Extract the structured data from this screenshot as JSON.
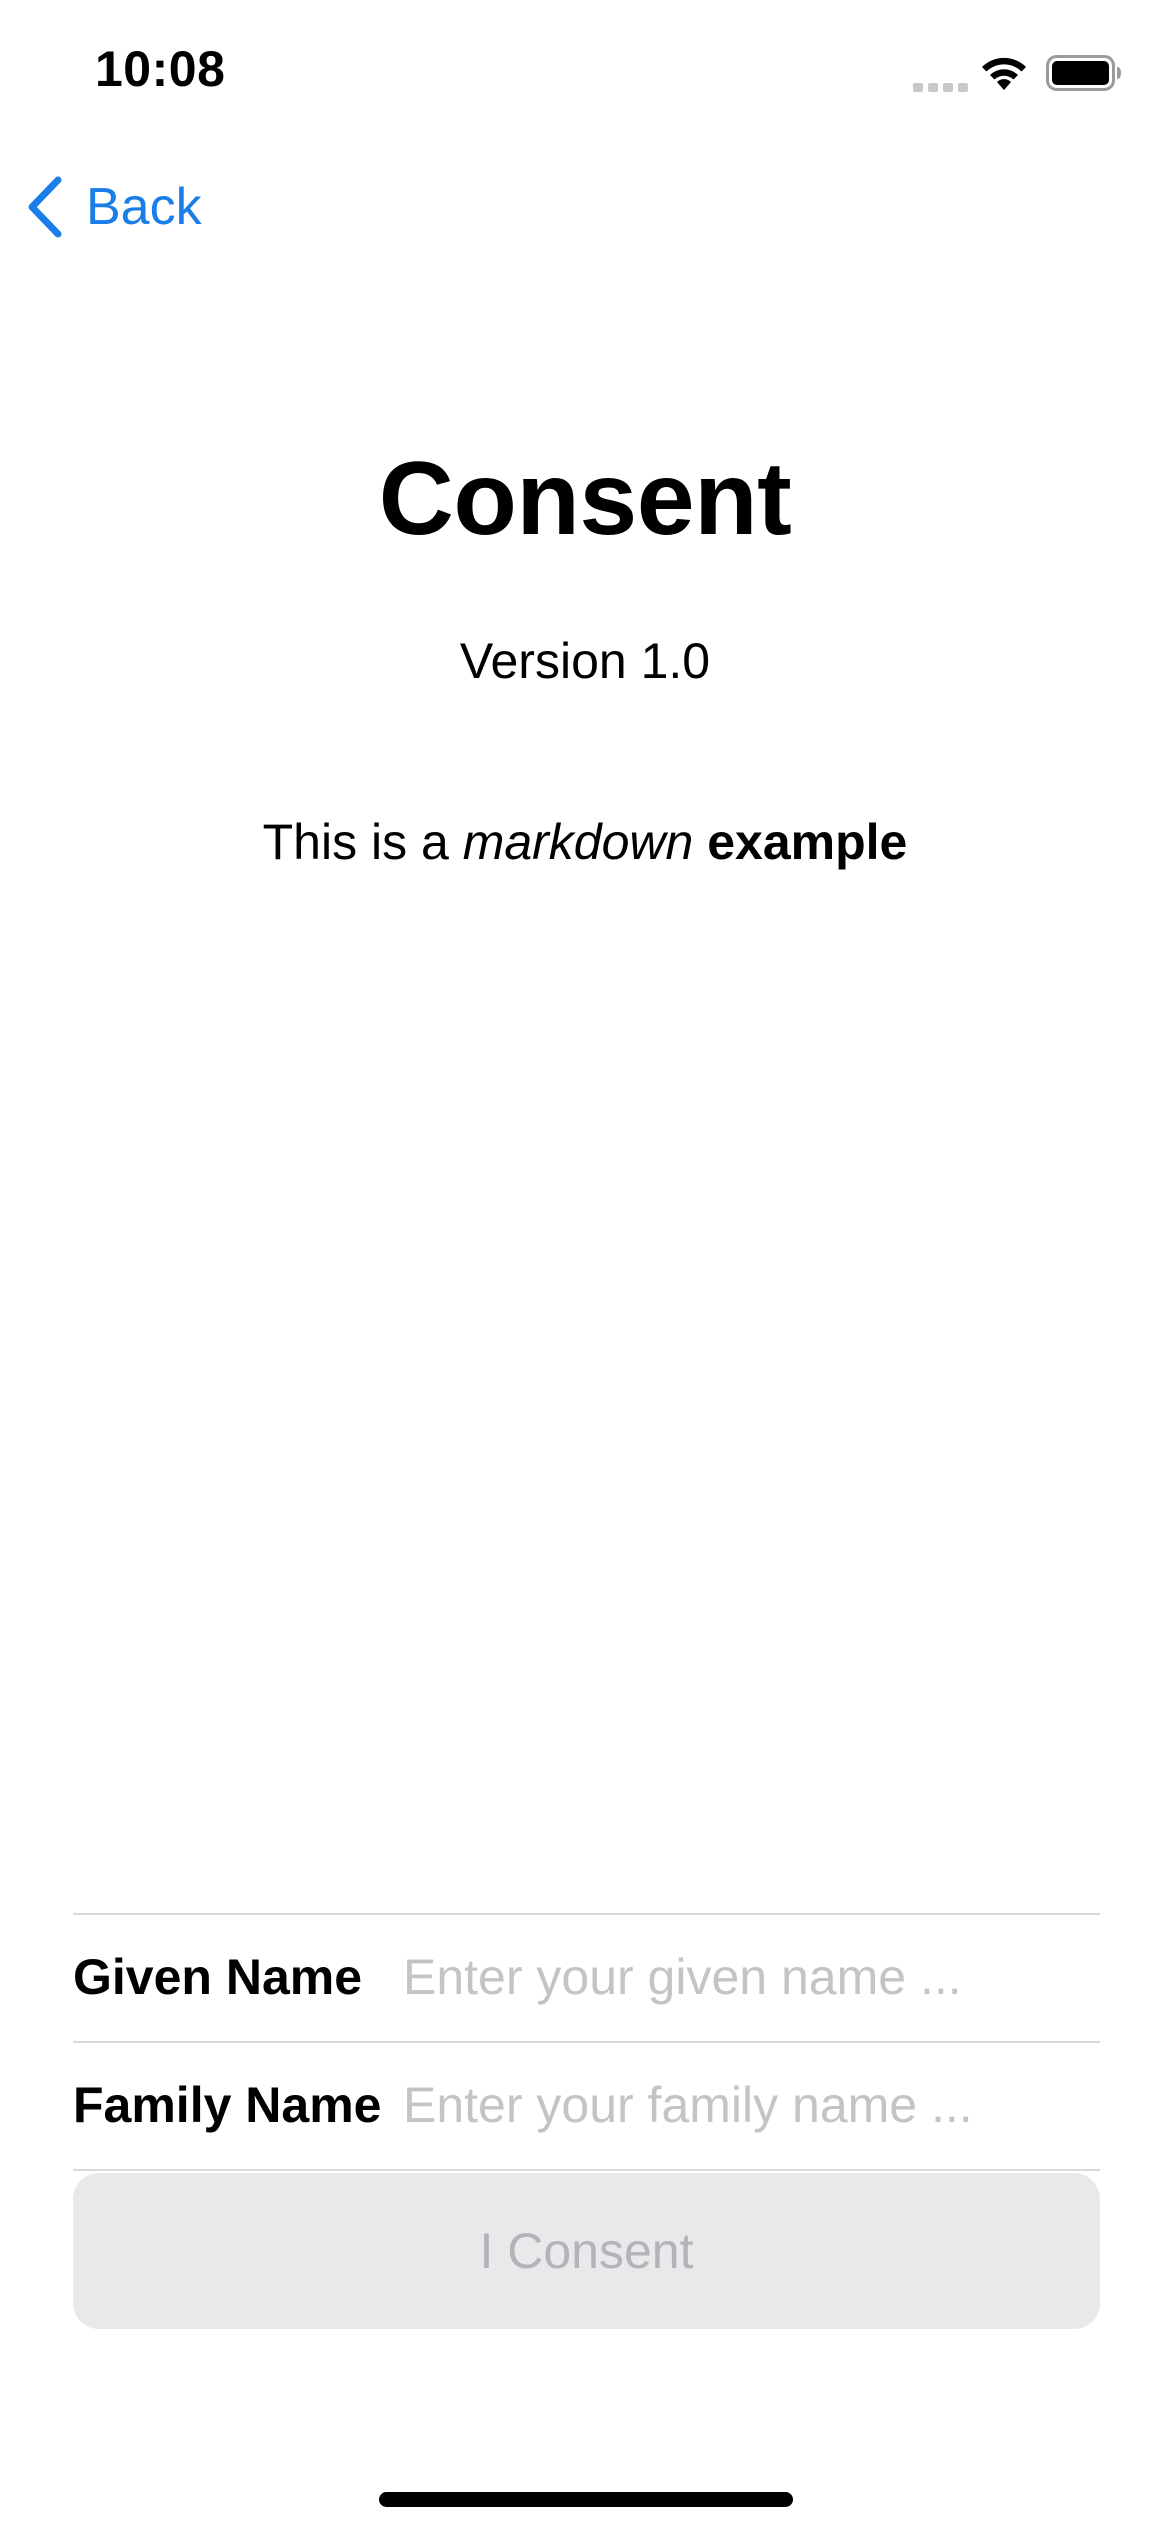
{
  "status_bar": {
    "time": "10:08",
    "icons": [
      "signal-icon",
      "wifi-icon",
      "battery-icon"
    ]
  },
  "nav": {
    "back_label": "Back",
    "back_icon": "chevron-left-icon",
    "accent_color": "#1a7ee8"
  },
  "content": {
    "title": "Consent",
    "version": "Version 1.0",
    "body_plain": "This is a ",
    "body_italic": "markdown",
    "body_space": " ",
    "body_bold": "example"
  },
  "form": {
    "given_name": {
      "label": "Given Name",
      "value": "",
      "placeholder": "Enter your given name ..."
    },
    "family_name": {
      "label": "Family Name",
      "value": "",
      "placeholder": "Enter your family name ..."
    }
  },
  "consent_button": {
    "label": "I Consent",
    "enabled": false
  }
}
